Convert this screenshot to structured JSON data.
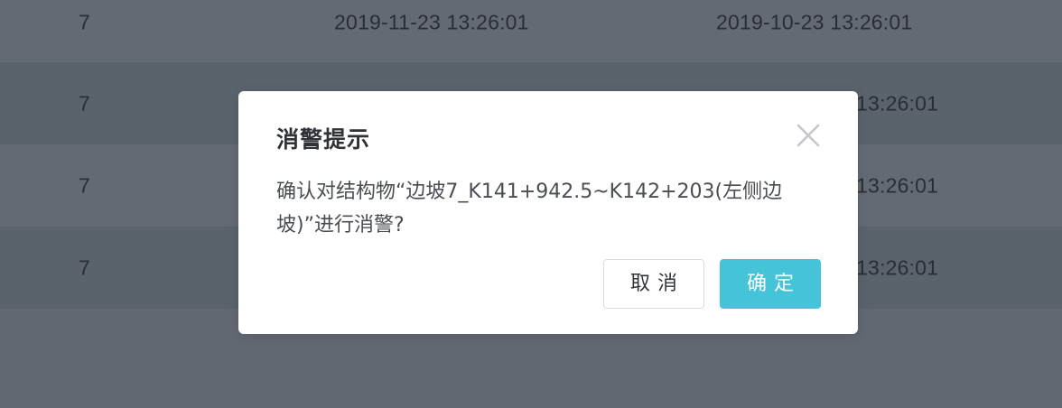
{
  "table": {
    "rows": [
      {
        "num": "7",
        "time1": "2019-11-23  13:26:01",
        "time2": "2019-10-23  13:26:01"
      },
      {
        "num": "7",
        "time1": "",
        "time2": "13:26:01"
      },
      {
        "num": "7",
        "time1": "",
        "time2": "13:26:01"
      },
      {
        "num": "7",
        "time1": "",
        "time2": "13:26:01"
      }
    ]
  },
  "dialog": {
    "title": "消警提示",
    "message": "确认对结构物“边坡7_K141+942.5~K142+203(左侧边坡)”进行消警?",
    "cancel_label": "取消",
    "confirm_label": "确定",
    "close_icon": "close-icon"
  },
  "colors": {
    "overlay_bg": "#626871",
    "confirm_button": "#45c4d9",
    "dialog_bg": "#ffffff"
  }
}
